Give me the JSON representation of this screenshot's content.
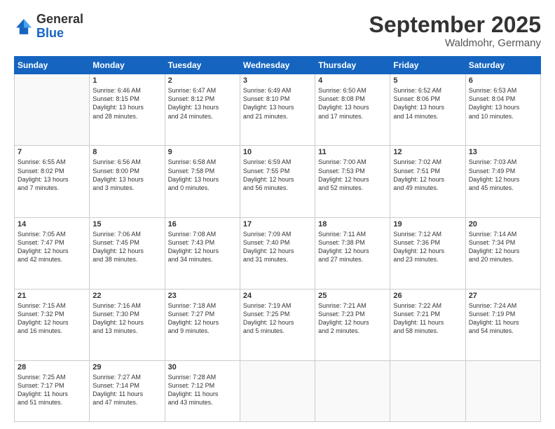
{
  "header": {
    "logo": {
      "general": "General",
      "blue": "Blue"
    },
    "title": "September 2025",
    "location": "Waldmohr, Germany"
  },
  "weekdays": [
    "Sunday",
    "Monday",
    "Tuesday",
    "Wednesday",
    "Thursday",
    "Friday",
    "Saturday"
  ],
  "weeks": [
    [
      {
        "day": "",
        "lines": []
      },
      {
        "day": "1",
        "lines": [
          "Sunrise: 6:46 AM",
          "Sunset: 8:15 PM",
          "Daylight: 13 hours",
          "and 28 minutes."
        ]
      },
      {
        "day": "2",
        "lines": [
          "Sunrise: 6:47 AM",
          "Sunset: 8:12 PM",
          "Daylight: 13 hours",
          "and 24 minutes."
        ]
      },
      {
        "day": "3",
        "lines": [
          "Sunrise: 6:49 AM",
          "Sunset: 8:10 PM",
          "Daylight: 13 hours",
          "and 21 minutes."
        ]
      },
      {
        "day": "4",
        "lines": [
          "Sunrise: 6:50 AM",
          "Sunset: 8:08 PM",
          "Daylight: 13 hours",
          "and 17 minutes."
        ]
      },
      {
        "day": "5",
        "lines": [
          "Sunrise: 6:52 AM",
          "Sunset: 8:06 PM",
          "Daylight: 13 hours",
          "and 14 minutes."
        ]
      },
      {
        "day": "6",
        "lines": [
          "Sunrise: 6:53 AM",
          "Sunset: 8:04 PM",
          "Daylight: 13 hours",
          "and 10 minutes."
        ]
      }
    ],
    [
      {
        "day": "7",
        "lines": [
          "Sunrise: 6:55 AM",
          "Sunset: 8:02 PM",
          "Daylight: 13 hours",
          "and 7 minutes."
        ]
      },
      {
        "day": "8",
        "lines": [
          "Sunrise: 6:56 AM",
          "Sunset: 8:00 PM",
          "Daylight: 13 hours",
          "and 3 minutes."
        ]
      },
      {
        "day": "9",
        "lines": [
          "Sunrise: 6:58 AM",
          "Sunset: 7:58 PM",
          "Daylight: 13 hours",
          "and 0 minutes."
        ]
      },
      {
        "day": "10",
        "lines": [
          "Sunrise: 6:59 AM",
          "Sunset: 7:55 PM",
          "Daylight: 12 hours",
          "and 56 minutes."
        ]
      },
      {
        "day": "11",
        "lines": [
          "Sunrise: 7:00 AM",
          "Sunset: 7:53 PM",
          "Daylight: 12 hours",
          "and 52 minutes."
        ]
      },
      {
        "day": "12",
        "lines": [
          "Sunrise: 7:02 AM",
          "Sunset: 7:51 PM",
          "Daylight: 12 hours",
          "and 49 minutes."
        ]
      },
      {
        "day": "13",
        "lines": [
          "Sunrise: 7:03 AM",
          "Sunset: 7:49 PM",
          "Daylight: 12 hours",
          "and 45 minutes."
        ]
      }
    ],
    [
      {
        "day": "14",
        "lines": [
          "Sunrise: 7:05 AM",
          "Sunset: 7:47 PM",
          "Daylight: 12 hours",
          "and 42 minutes."
        ]
      },
      {
        "day": "15",
        "lines": [
          "Sunrise: 7:06 AM",
          "Sunset: 7:45 PM",
          "Daylight: 12 hours",
          "and 38 minutes."
        ]
      },
      {
        "day": "16",
        "lines": [
          "Sunrise: 7:08 AM",
          "Sunset: 7:43 PM",
          "Daylight: 12 hours",
          "and 34 minutes."
        ]
      },
      {
        "day": "17",
        "lines": [
          "Sunrise: 7:09 AM",
          "Sunset: 7:40 PM",
          "Daylight: 12 hours",
          "and 31 minutes."
        ]
      },
      {
        "day": "18",
        "lines": [
          "Sunrise: 7:11 AM",
          "Sunset: 7:38 PM",
          "Daylight: 12 hours",
          "and 27 minutes."
        ]
      },
      {
        "day": "19",
        "lines": [
          "Sunrise: 7:12 AM",
          "Sunset: 7:36 PM",
          "Daylight: 12 hours",
          "and 23 minutes."
        ]
      },
      {
        "day": "20",
        "lines": [
          "Sunrise: 7:14 AM",
          "Sunset: 7:34 PM",
          "Daylight: 12 hours",
          "and 20 minutes."
        ]
      }
    ],
    [
      {
        "day": "21",
        "lines": [
          "Sunrise: 7:15 AM",
          "Sunset: 7:32 PM",
          "Daylight: 12 hours",
          "and 16 minutes."
        ]
      },
      {
        "day": "22",
        "lines": [
          "Sunrise: 7:16 AM",
          "Sunset: 7:30 PM",
          "Daylight: 12 hours",
          "and 13 minutes."
        ]
      },
      {
        "day": "23",
        "lines": [
          "Sunrise: 7:18 AM",
          "Sunset: 7:27 PM",
          "Daylight: 12 hours",
          "and 9 minutes."
        ]
      },
      {
        "day": "24",
        "lines": [
          "Sunrise: 7:19 AM",
          "Sunset: 7:25 PM",
          "Daylight: 12 hours",
          "and 5 minutes."
        ]
      },
      {
        "day": "25",
        "lines": [
          "Sunrise: 7:21 AM",
          "Sunset: 7:23 PM",
          "Daylight: 12 hours",
          "and 2 minutes."
        ]
      },
      {
        "day": "26",
        "lines": [
          "Sunrise: 7:22 AM",
          "Sunset: 7:21 PM",
          "Daylight: 11 hours",
          "and 58 minutes."
        ]
      },
      {
        "day": "27",
        "lines": [
          "Sunrise: 7:24 AM",
          "Sunset: 7:19 PM",
          "Daylight: 11 hours",
          "and 54 minutes."
        ]
      }
    ],
    [
      {
        "day": "28",
        "lines": [
          "Sunrise: 7:25 AM",
          "Sunset: 7:17 PM",
          "Daylight: 11 hours",
          "and 51 minutes."
        ]
      },
      {
        "day": "29",
        "lines": [
          "Sunrise: 7:27 AM",
          "Sunset: 7:14 PM",
          "Daylight: 11 hours",
          "and 47 minutes."
        ]
      },
      {
        "day": "30",
        "lines": [
          "Sunrise: 7:28 AM",
          "Sunset: 7:12 PM",
          "Daylight: 11 hours",
          "and 43 minutes."
        ]
      },
      {
        "day": "",
        "lines": []
      },
      {
        "day": "",
        "lines": []
      },
      {
        "day": "",
        "lines": []
      },
      {
        "day": "",
        "lines": []
      }
    ]
  ]
}
